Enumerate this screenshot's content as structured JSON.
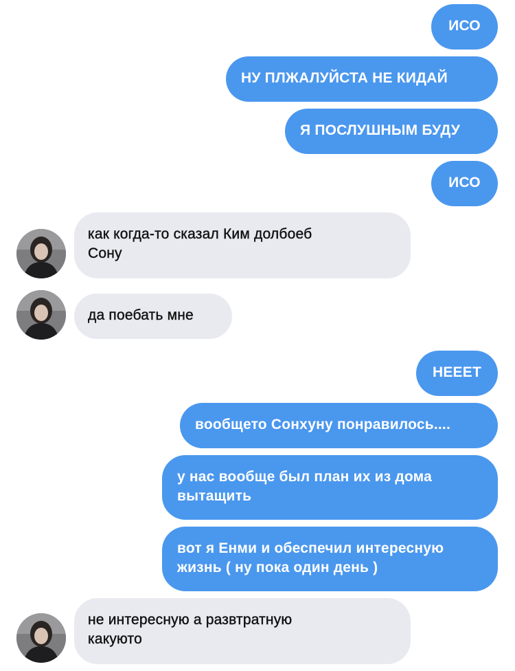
{
  "messages": [
    {
      "direction": "outgoing",
      "text": "ИСО"
    },
    {
      "direction": "outgoing",
      "text": "НУ ПЛЖАЛУЙСТА НЕ КИДАЙ"
    },
    {
      "direction": "outgoing",
      "text": "Я ПОСЛУШНЫМ БУДУ"
    },
    {
      "direction": "outgoing",
      "text": "ИСО"
    },
    {
      "direction": "incoming",
      "text": "как когда-то сказал Ким долбоеб\nСону"
    },
    {
      "direction": "incoming",
      "text": "да поебать мне"
    },
    {
      "direction": "outgoing",
      "text": "НЕЕЕТ"
    },
    {
      "direction": "outgoing",
      "text": "вообщето Сонхуну понравилось...."
    },
    {
      "direction": "outgoing",
      "text": "у нас вообще был план их из дома\nвытащить"
    },
    {
      "direction": "outgoing",
      "text": "вот я Енми и обеспечил интересную\nжизнь ( ну пока один день )"
    },
    {
      "direction": "incoming",
      "text": "не интересную а развтратную\nкакуюто"
    }
  ],
  "colors": {
    "outgoing_bubble": "#4a97ee",
    "incoming_bubble": "#e9eaf0",
    "outgoing_text": "#ffffff",
    "incoming_text": "#111111"
  },
  "avatar_icon": "user-photo-avatar"
}
